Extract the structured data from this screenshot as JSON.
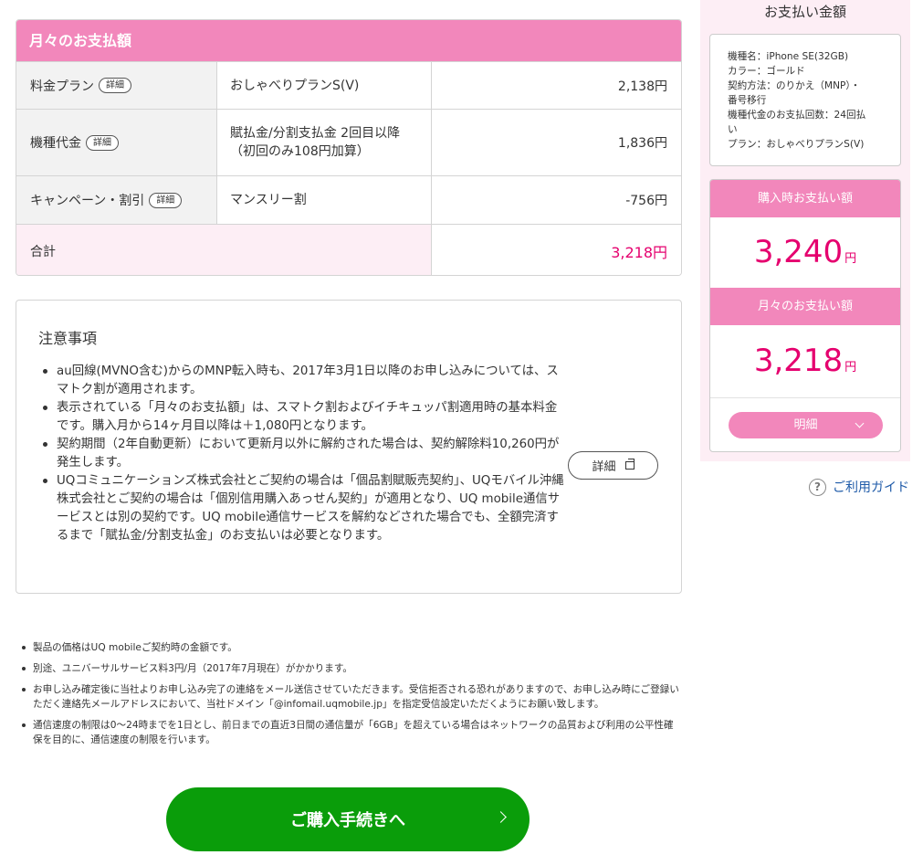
{
  "monthly": {
    "header": "月々のお支払額",
    "detail_label": "詳細",
    "rows": [
      {
        "label": "料金プラン",
        "content": "おしゃべりプランS(V)",
        "amount": "2,138円"
      },
      {
        "label": "機種代金",
        "content_line1": "賦払金/分割支払金 2回目以降",
        "content_line2": "（初回のみ108円加算）",
        "amount": "1,836円"
      },
      {
        "label": "キャンペーン・割引",
        "content": "マンスリー割",
        "amount": "-756円"
      }
    ],
    "total": {
      "label": "合計",
      "amount": "3,218円"
    }
  },
  "notes": {
    "title": "注意事項",
    "items": [
      "au回線(MVNO含む)からのMNP転入時も、2017年3月1日以降のお申し込みについては、スマトク割が適用されます。",
      "表示されている「月々のお支払額」は、スマトク割およびイチキュッパ割適用時の基本料金です。購入月から14ヶ月目以降は＋1,080円となります。",
      "契約期間（2年自動更新）において更新月以外に解約された場合は、契約解除料10,260円が発生します。",
      "UQコミュニケーションズ株式会社とご契約の場合は「個品割賦販売契約」、UQモバイル沖縄株式会社とご契約の場合は「個別信用購入あっせん契約」が適用となり、UQ mobile通信サービスとは別の契約です。UQ mobile通信サービスを解約などされた場合でも、全額完済するまで「賦払金/分割支払金」のお支払いは必要となります。"
    ],
    "detail_button": "詳細"
  },
  "footnotes": [
    "製品の価格はUQ mobileご契約時の金額です。",
    "別途、ユニバーサルサービス料3円/月（2017年7月現在）がかかります。",
    "お申し込み確定後に当社よりお申し込み完了の連絡をメール送信させていただきます。受信拒否される恐れがありますので、お申し込み時にご登録いただく連絡先メールアドレスにおいて、当社ドメイン「@infomail.uqmobile.jp」を指定受信設定いただくようにお願い致します。",
    "通信速度の制限は0～24時までを1日とし、前日までの直近3日間の通信量が「6GB」を超えている場合はネットワークの品質および利用の公平性確保を目的に、通信速度の制限を行います。"
  ],
  "proceed_button": "ご購入手続きへ",
  "summary": {
    "title": "お支払い金額",
    "device_lines": [
      "機種名：iPhone SE(32GB)",
      "カラー：ゴールド",
      "契約方法：のりかえ（MNP）・",
      "番号移行",
      "機種代金のお支払回数：24回払",
      "い",
      "プラン：おしゃべりプランS(V)"
    ],
    "purchase_label": "購入時お支払い額",
    "purchase_amount": "3,240",
    "monthly_label": "月々のお支払い額",
    "monthly_amount": "3,218",
    "unit": "円",
    "meisai_button": "明細"
  },
  "guide_link": "ご利用ガイド",
  "help_icon_glyph": "?",
  "colors": {
    "accent_pink": "#f287bb",
    "price_magenta": "#e5006e",
    "proceed_green": "#0a9d0a",
    "link_blue": "#1e5aa8"
  }
}
